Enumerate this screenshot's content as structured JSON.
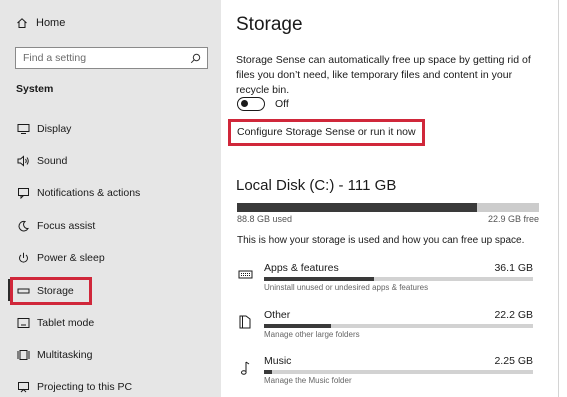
{
  "sidebar": {
    "home_label": "Home",
    "search_placeholder": "Find a setting",
    "section_title": "System",
    "items": [
      {
        "label": "Display",
        "icon": "display-icon"
      },
      {
        "label": "Sound",
        "icon": "speaker-icon"
      },
      {
        "label": "Notifications & actions",
        "icon": "notification-icon"
      },
      {
        "label": "Focus assist",
        "icon": "moon-icon"
      },
      {
        "label": "Power & sleep",
        "icon": "power-icon"
      },
      {
        "label": "Storage",
        "icon": "storage-icon",
        "selected": true
      },
      {
        "label": "Tablet mode",
        "icon": "tablet-icon"
      },
      {
        "label": "Multitasking",
        "icon": "multitasking-icon"
      },
      {
        "label": "Projecting to this PC",
        "icon": "projecting-icon"
      }
    ]
  },
  "main": {
    "title": "Storage",
    "description": "Storage Sense can automatically free up space by getting rid of files you don’t need, like temporary files and content in your recycle bin.",
    "toggle": {
      "state_label": "Off",
      "on": false
    },
    "configure_link": "Configure Storage Sense or run it now",
    "disk": {
      "title": "Local Disk (C:) - 111 GB",
      "used_label": "88.8 GB used",
      "free_label": "22.9 GB free",
      "used_fraction": 0.795
    },
    "usage_description": "This is how your storage is used and how you can free up space.",
    "categories": [
      {
        "name": "Apps & features",
        "size": "36.1 GB",
        "subtitle": "Uninstall unused or undesired apps & features",
        "fraction": 0.41,
        "icon": "apps-icon"
      },
      {
        "name": "Other",
        "size": "22.2 GB",
        "subtitle": "Manage other large folders",
        "fraction": 0.25,
        "icon": "folder-icon"
      },
      {
        "name": "Music",
        "size": "2.25 GB",
        "subtitle": "Manage the Music folder",
        "fraction": 0.03,
        "icon": "music-icon"
      }
    ]
  },
  "colors": {
    "highlight": "#d0273a",
    "sidebar_bg": "#e6e6e6",
    "bar_fill": "#3a3a3a",
    "bar_track": "#cccccc"
  }
}
